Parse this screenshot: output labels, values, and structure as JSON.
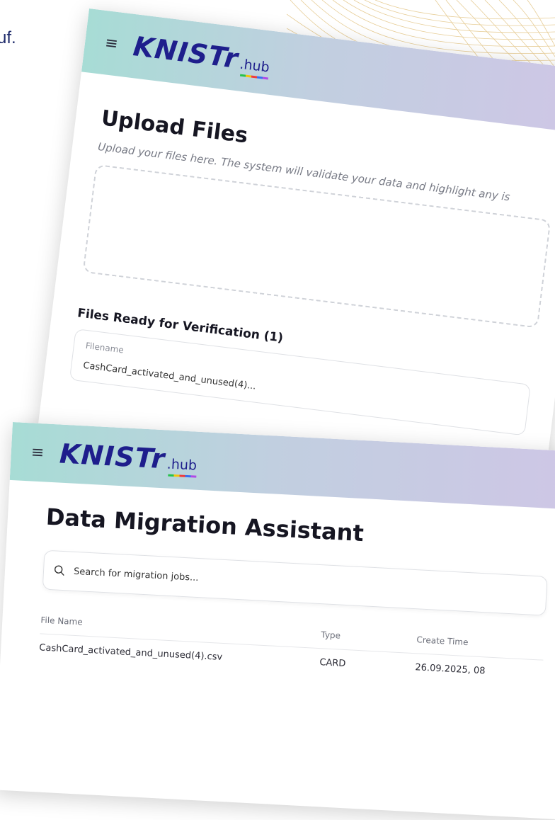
{
  "background": {
    "text": "uf."
  },
  "panel1": {
    "menu_icon": "≡",
    "logo_main": "KNISTr",
    "logo_hub": ".hub",
    "title": "Upload Files",
    "subtitle": "Upload your files here. The system will validate your data and highlight any is",
    "files_section_title": "Files Ready for Verification (1)",
    "files_table": {
      "column": "Filename",
      "row": "CashCard_activated_and_unused(4)..."
    }
  },
  "panel2": {
    "menu_icon": "≡",
    "logo_main": "KNISTr",
    "logo_hub": ".hub",
    "title": "Data Migration Assistant",
    "search": {
      "placeholder": "Search for migration jobs..."
    },
    "table": {
      "headers": [
        "File Name",
        "Type",
        "Create Time"
      ],
      "rows": [
        [
          "CashCard_activated_and_unused(4).csv",
          "CARD",
          "26.09.2025, 08"
        ]
      ]
    }
  },
  "colors": {
    "brand": "#1e1e8c",
    "header_gradient_start": "#a7dcd5",
    "header_gradient_end": "#cfc6e6"
  }
}
